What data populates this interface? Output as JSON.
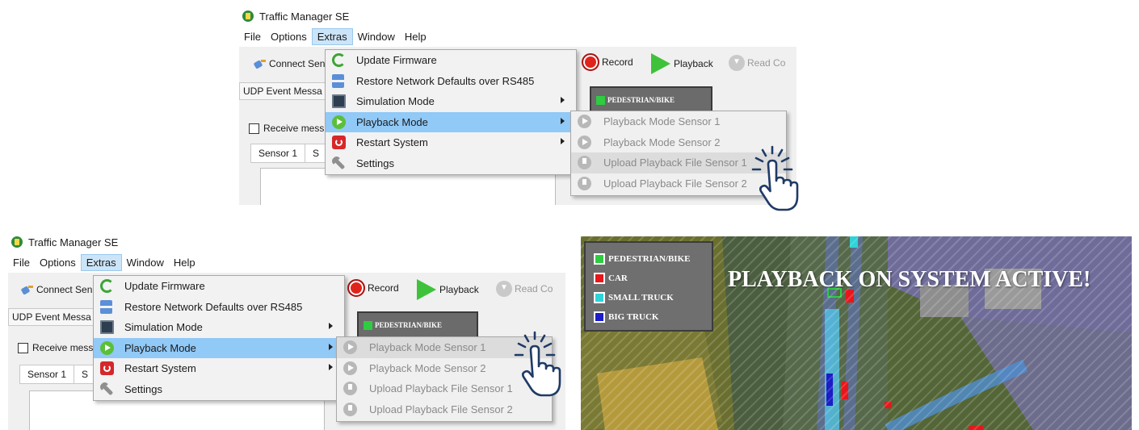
{
  "app_title": "Traffic Manager SE",
  "menubar": [
    "File",
    "Options",
    "Extras",
    "Window",
    "Help"
  ],
  "toolbar": {
    "connect_label": "Connect Sen",
    "record_label": "Record",
    "playback_label": "Playback",
    "read_label": "Read Co"
  },
  "panel_tab_label": "UDP Event Messa",
  "receive_checkbox_label": "Receive mess",
  "subtabs": [
    "Sensor 1",
    "S"
  ],
  "mini_legend_label": "PEDESTRIAN/BIKE",
  "extras_menu": [
    {
      "label": "Update Firmware",
      "icon": "update-firmware-icon",
      "submenu": false
    },
    {
      "label": "Restore Network Defaults over RS485",
      "icon": "network-icon",
      "submenu": false
    },
    {
      "label": "Simulation Mode",
      "icon": "simulation-icon",
      "submenu": true
    },
    {
      "label": "Playback Mode",
      "icon": "playback-mode-icon",
      "submenu": true,
      "highlighted": true
    },
    {
      "label": "Restart System",
      "icon": "power-icon",
      "submenu": true
    },
    {
      "label": "Settings",
      "icon": "wrench-icon",
      "submenu": false
    }
  ],
  "playback_submenu": [
    {
      "label": "Playback Mode Sensor 1",
      "icon": "grey-play-icon"
    },
    {
      "label": "Playback Mode Sensor 2",
      "icon": "grey-play-icon"
    },
    {
      "label": "Upload Playback File Sensor 1",
      "icon": "grey-upload-icon"
    },
    {
      "label": "Upload Playback File Sensor 2",
      "icon": "grey-upload-icon"
    }
  ],
  "top_panel_hover": "Upload Playback File Sensor 1",
  "bottom_panel_hover": "Playback Mode Sensor 1",
  "map_overlay": {
    "title": "PLAYBACK ON SYSTEM ACTIVE!",
    "legend": [
      {
        "label": "PEDESTRIAN/BIKE",
        "color": "#2ecc40"
      },
      {
        "label": "CAR",
        "color": "#e8161b"
      },
      {
        "label": "SMALL TRUCK",
        "color": "#2fd3d8"
      },
      {
        "label": "BIG TRUCK",
        "color": "#1c1cc8"
      }
    ]
  },
  "colors": {
    "menu_highlight": "#91c9f7",
    "menubar_active": "#cce4f7",
    "cursor": "#1f3a66"
  }
}
